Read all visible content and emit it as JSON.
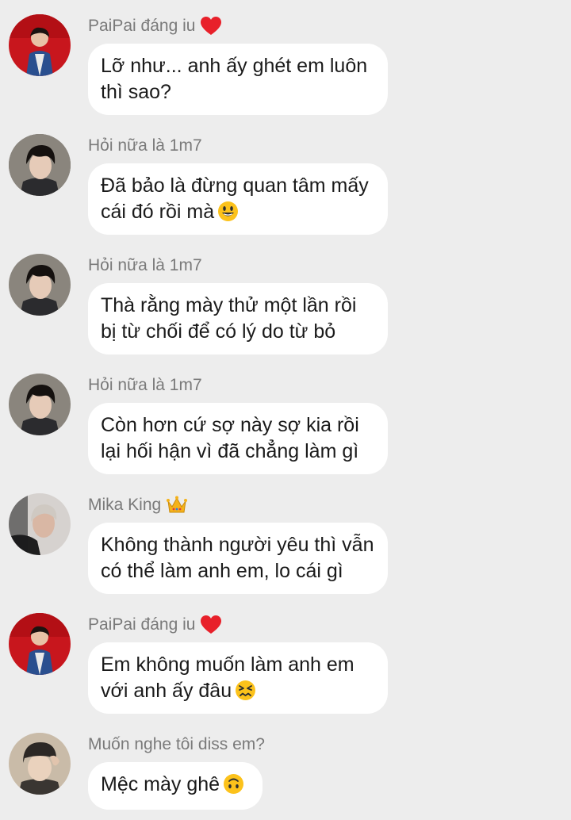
{
  "messages": [
    {
      "sender": "PaiPai đáng iu",
      "badge": "red-heart",
      "avatar": "red-background-portrait",
      "lines": [
        "Lỡ như... anh ấy ghét em luôn",
        "thì sao?"
      ],
      "emoji": ""
    },
    {
      "sender": "Hỏi nữa là 1m7",
      "badge": "",
      "avatar": "dark-hair-portrait",
      "lines": [
        "Đã bảo là đừng quan tâm mấy",
        "cái đó rồi mà"
      ],
      "emoji": "grinning-face"
    },
    {
      "sender": "Hỏi nữa là 1m7",
      "badge": "",
      "avatar": "dark-hair-portrait",
      "lines": [
        "Thà rằng mày thử một lần rồi",
        "bị từ chối để có lý do từ bỏ"
      ],
      "emoji": ""
    },
    {
      "sender": "Hỏi nữa là 1m7",
      "badge": "",
      "avatar": "dark-hair-portrait",
      "lines": [
        "Còn hơn cứ sợ này sợ kia rồi",
        "lại hối hận vì đã chẳng làm gì"
      ],
      "emoji": ""
    },
    {
      "sender": "Mika King",
      "badge": "crown",
      "avatar": "light-hair-portrait",
      "lines": [
        "Không thành người yêu thì vẫn",
        "có thể làm anh em, lo cái gì"
      ],
      "emoji": ""
    },
    {
      "sender": "PaiPai đáng iu",
      "badge": "red-heart",
      "avatar": "red-background-portrait",
      "lines": [
        "Em không muốn làm anh em",
        "với anh ấy đâu"
      ],
      "emoji": "confounded-face"
    },
    {
      "sender": "Muốn nghe tôi diss em?",
      "badge": "",
      "avatar": "beanie-portrait",
      "lines": [
        "Mệc mày ghê"
      ],
      "emoji": "upside-down-face"
    }
  ]
}
